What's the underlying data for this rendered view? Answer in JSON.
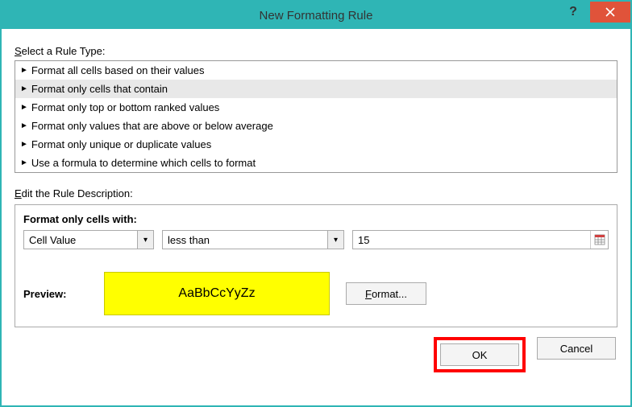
{
  "title": "New Formatting Rule",
  "section": {
    "select_label": "Select a Rule Type:",
    "edit_label": "Edit the Rule Description:"
  },
  "rules": [
    "Format all cells based on their values",
    "Format only cells that contain",
    "Format only top or bottom ranked values",
    "Format only values that are above or below average",
    "Format only unique or duplicate values",
    "Use a formula to determine which cells to format"
  ],
  "selected_rule_index": 1,
  "desc": {
    "group_label": "Format only cells with:",
    "combo1": "Cell Value",
    "combo2": "less than",
    "value": "15"
  },
  "preview": {
    "label": "Preview:",
    "sample": "AaBbCcYyZz",
    "format_btn": "Format..."
  },
  "buttons": {
    "ok": "OK",
    "cancel": "Cancel"
  }
}
